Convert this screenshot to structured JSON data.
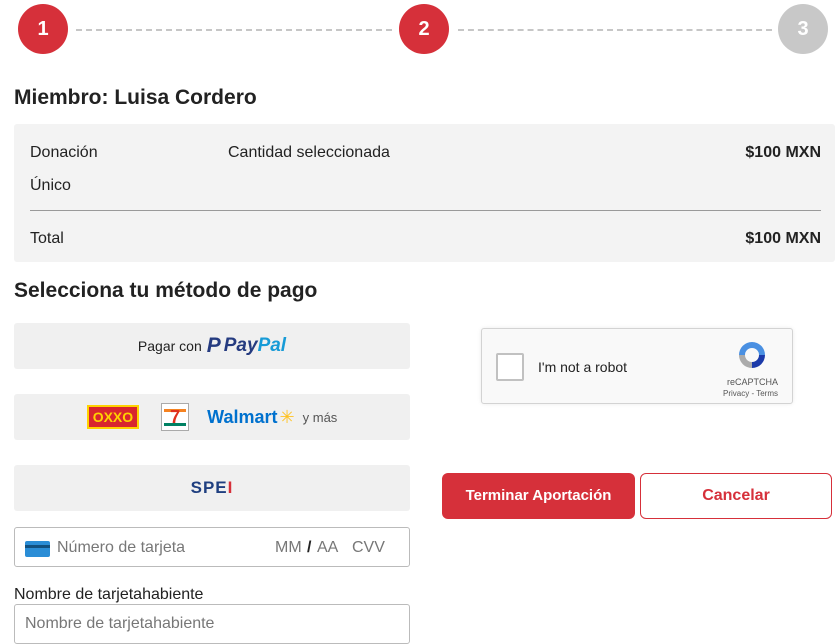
{
  "stepper": {
    "steps": [
      {
        "number": "1",
        "state": "active"
      },
      {
        "number": "2",
        "state": "active"
      },
      {
        "number": "3",
        "state": "inactive"
      }
    ],
    "active_color": "#d6303a",
    "inactive_color": "#c8c8c8"
  },
  "member": {
    "title": "Miembro: Luisa Cordero"
  },
  "summary": {
    "donation_label": "Donación",
    "selected_label": "Cantidad seleccionada",
    "amount": "$100 MXN",
    "frequency": "Único",
    "total_label": "Total",
    "total_amount": "$100 MXN"
  },
  "payment": {
    "title": "Selecciona tu método de pago",
    "paypal": {
      "prefix": "Pagar con",
      "brand_p": "P",
      "brand_pay": "Pay",
      "brand_pal": "Pal"
    },
    "cash": {
      "oxxo": "OXXO",
      "seven": "7",
      "walmart": "Walmart",
      "spark": "✳",
      "more": "y más"
    },
    "spei": {
      "label_main": "SPE",
      "label_mark": "I"
    }
  },
  "card": {
    "number_placeholder": "Número de tarjeta",
    "mm": "MM",
    "slash": "/",
    "aa": "AA",
    "cvv": "CVV"
  },
  "holder": {
    "label": "Nombre de tarjetahabiente",
    "placeholder": "Nombre de tarjetahabiente",
    "value": ""
  },
  "recaptcha": {
    "label": "I'm not a robot",
    "brand": "reCAPTCHA",
    "links": "Privacy - Terms"
  },
  "actions": {
    "submit_label": "Terminar Aportación",
    "cancel_label": "Cancelar"
  },
  "colors": {
    "accent": "#d6303a",
    "summary_bg": "#f3f3f3",
    "payment_bg": "#f0f0f0"
  }
}
